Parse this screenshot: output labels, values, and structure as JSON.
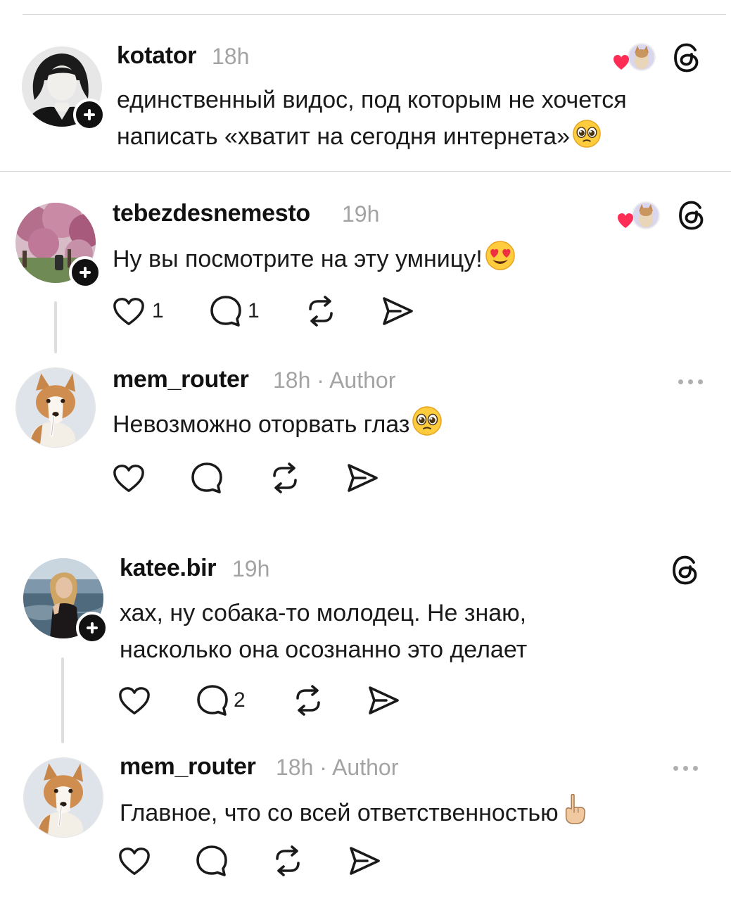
{
  "comments": [
    {
      "username": "kotator",
      "time": "18h",
      "text_lines": [
        "единственный видос, под которым не хочется",
        "написать «хватит на сегодня интернета»"
      ]
    },
    {
      "username": "tebezdesnemesto",
      "time": "19h",
      "text_lines": [
        "Ну вы посмотрите на эту умницу!"
      ],
      "likes": "1",
      "replies": "1"
    },
    {
      "username": "mem_router",
      "time": "18h · Author",
      "text_lines": [
        "Невозможно оторвать глаз"
      ]
    },
    {
      "username": "katee.bir",
      "time": "19h",
      "text_lines": [
        "хах, ну собака-то молодец. Не знаю,",
        "насколько она осознанно это делает"
      ],
      "replies": "2"
    },
    {
      "username": "mem_router",
      "time": "18h · Author",
      "text_lines": [
        "Главное, что со всей ответственностью"
      ]
    }
  ],
  "icons": {
    "follow": "plus-icon",
    "threads": "threads-logo-icon",
    "liked_by_author": "heart-avatar-icon",
    "like": "heart-outline-icon",
    "reply": "speech-bubble-icon",
    "repost": "repost-icon",
    "share": "send-icon",
    "more": "ellipsis-icon"
  },
  "colors": {
    "text": "#111111",
    "meta": "#a3a3a3",
    "heart": "#ff2d55"
  }
}
